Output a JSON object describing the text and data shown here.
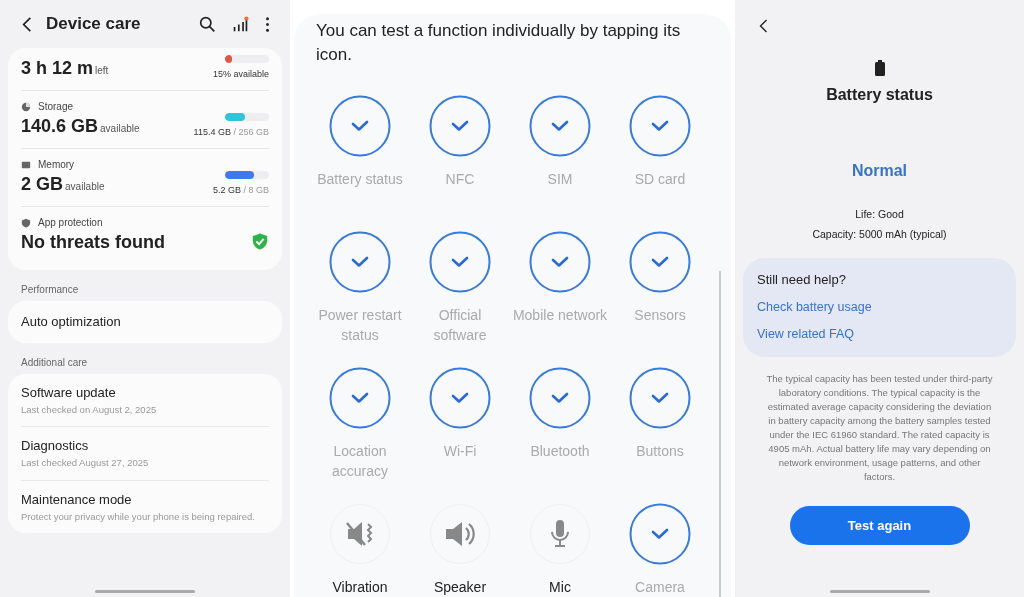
{
  "device_care": {
    "title": "Device care",
    "battery": {
      "value": "3 h 12 m",
      "unit": "left",
      "level": 0.15,
      "reading": "15% available",
      "color": "#e05545"
    },
    "meters": [
      {
        "label": "Storage",
        "value": "140.6 GB",
        "unit": "available",
        "level": 0.45,
        "used": "115.4 GB",
        "total": "/ 256 GB",
        "color": "#2fc4dc"
      },
      {
        "label": "Memory",
        "value": "2 GB",
        "unit": "available",
        "level": 0.65,
        "used": "5.2 GB",
        "total": "/ 8 GB",
        "color": "#3a7cf0"
      }
    ],
    "protection": {
      "label": "App protection",
      "value": "No threats found"
    },
    "sections": [
      {
        "heading": "Performance",
        "items": [
          {
            "title": "Auto optimization"
          }
        ]
      },
      {
        "heading": "Additional care",
        "items": [
          {
            "title": "Software update",
            "subtitle": "Last checked on August 2, 2025"
          },
          {
            "title": "Diagnostics",
            "subtitle": "Last checked August 27, 2025"
          },
          {
            "title": "Maintenance mode",
            "subtitle": "Protect your privacy while your phone is being repaired."
          }
        ]
      }
    ]
  },
  "diagnostics": {
    "intro": "You can test a function individually by tapping its icon.",
    "tests": [
      {
        "label": "Battery status",
        "kind": "check"
      },
      {
        "label": "NFC",
        "kind": "check"
      },
      {
        "label": "SIM",
        "kind": "check"
      },
      {
        "label": "SD card",
        "kind": "check"
      },
      {
        "label": "Power restart status",
        "kind": "check"
      },
      {
        "label": "Official software",
        "kind": "check"
      },
      {
        "label": "Mobile network",
        "kind": "check"
      },
      {
        "label": "Sensors",
        "kind": "check"
      },
      {
        "label": "Location accuracy",
        "kind": "check"
      },
      {
        "label": "Wi-Fi",
        "kind": "check"
      },
      {
        "label": "Bluetooth",
        "kind": "check"
      },
      {
        "label": "Buttons",
        "kind": "check"
      },
      {
        "label": "Vibration",
        "kind": "vibration"
      },
      {
        "label": "Speaker",
        "kind": "speaker"
      },
      {
        "label": "Mic",
        "kind": "mic"
      },
      {
        "label": "Camera",
        "kind": "check"
      }
    ]
  },
  "battery_status": {
    "title": "Battery status",
    "status": "Normal",
    "details": [
      "Life: Good",
      "Capacity: 5000 mAh (typical)"
    ],
    "help": {
      "heading": "Still need help?",
      "links": [
        "Check battery usage",
        "View related FAQ"
      ]
    },
    "note": "The typical capacity has been tested under third-party laboratory conditions. The typical capacity is the estimated average capacity considering the deviation in battery capacity among the battery samples tested under the IEC 61960 standard. The rated capacity is 4905 mAh. Actual battery life may vary depending on network environment, usage patterns, and other factors.",
    "button": "Test again"
  }
}
